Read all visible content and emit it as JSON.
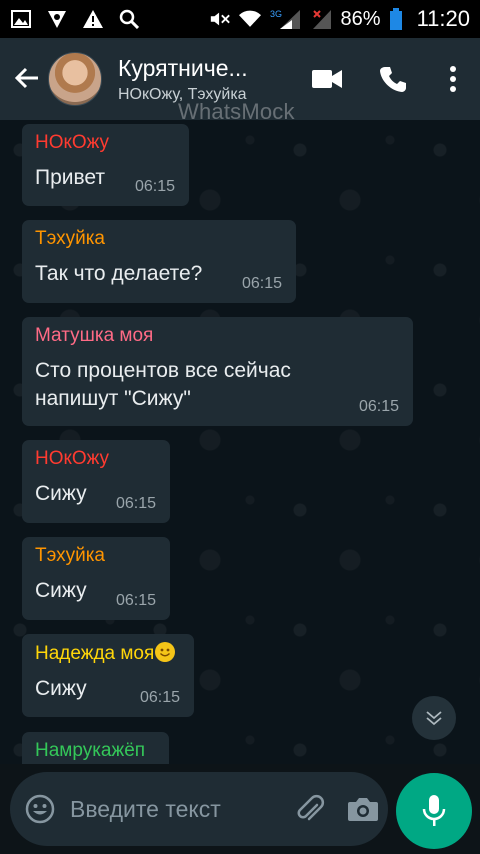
{
  "status_bar": {
    "battery": "86%",
    "time": "11:20",
    "network": "3G",
    "icons": [
      "image-icon",
      "app-icon",
      "warning-icon",
      "search-icon",
      "mute-icon",
      "wifi-icon",
      "signal-icon",
      "battery-icon"
    ]
  },
  "header": {
    "title": "Курятниче...",
    "subtitle": "НОкОжу, Тэхуйка",
    "watermark": "WhatsMock"
  },
  "messages": [
    {
      "sender": "НОкОжу",
      "sender_color": "#ff3b30",
      "text": "Привет",
      "time": "06:15"
    },
    {
      "sender": "Тэхуйка",
      "sender_color": "#ff9500",
      "text": "Так что делаете?",
      "time": "06:15"
    },
    {
      "sender": "Матушка моя",
      "sender_color": "#ff6b86",
      "text": "Сто процентов все сейчас напишут \"Сижу\"",
      "time": "06:15"
    },
    {
      "sender": "НОкОжу",
      "sender_color": "#ff3b30",
      "text": "Сижу",
      "time": "06:15"
    },
    {
      "sender": "Тэхуйка",
      "sender_color": "#ff9500",
      "text": "Сижу",
      "time": "06:15"
    },
    {
      "sender": "Надежда моя",
      "sender_color": "#ffd60a",
      "text": "Сижу",
      "time": "06:15"
    },
    {
      "sender": "Намрукажёп",
      "sender_color": "#34c759",
      "text": "",
      "time": ""
    }
  ],
  "composer": {
    "placeholder": "Введите текст"
  },
  "colors": {
    "header_bg": "#1f2c34",
    "bubble_bg": "#1f2c34",
    "accent": "#00a884"
  }
}
